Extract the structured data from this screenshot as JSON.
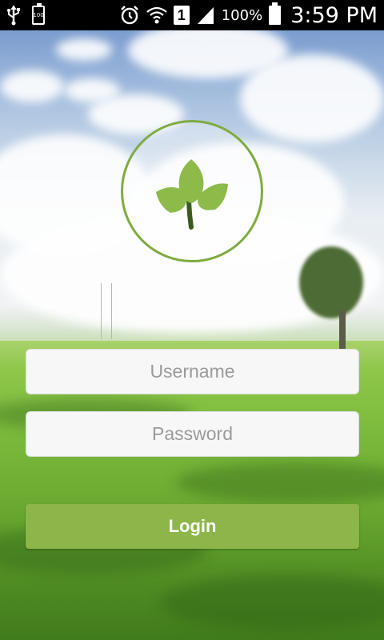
{
  "status_bar": {
    "battery_small_text": "100",
    "sim_label": "1",
    "battery_percent": "100%",
    "time": "3:59 PM",
    "icons": [
      "usb-icon",
      "battery-saver-icon",
      "alarm-icon",
      "wifi-icon",
      "sim-icon",
      "signal-icon",
      "battery-icon"
    ]
  },
  "login": {
    "username_placeholder": "Username",
    "password_placeholder": "Password",
    "login_label": "Login"
  },
  "colors": {
    "accent": "#8db54a",
    "logo_ring": "#7fab3f",
    "leaf": "#8dbb4a",
    "stem": "#3c5a1c"
  }
}
